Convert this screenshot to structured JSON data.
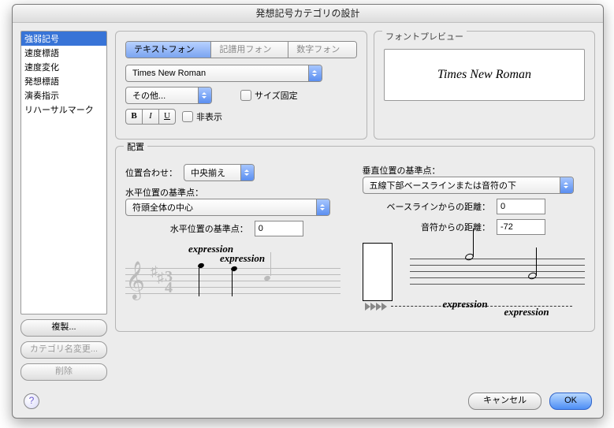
{
  "window": {
    "title": "発想記号カテゴリの設計"
  },
  "sidebar": {
    "items": [
      {
        "label": "強弱記号",
        "selected": true
      },
      {
        "label": "速度標語",
        "selected": false
      },
      {
        "label": "速度変化",
        "selected": false
      },
      {
        "label": "発想標語",
        "selected": false
      },
      {
        "label": "演奏指示",
        "selected": false
      },
      {
        "label": "リハーサルマーク",
        "selected": false
      }
    ],
    "duplicate": "複製...",
    "rename": "カテゴリ名変更...",
    "delete": "削除"
  },
  "tabs": {
    "text_font": "テキストフォント",
    "music_font": "記譜用フォント",
    "number_font": "数字フォント"
  },
  "font": {
    "family": "Times New Roman",
    "other": "その他...",
    "fixed_size_label": "サイズ固定",
    "hide_label": "非表示",
    "bold_glyph": "B",
    "italic_glyph": "I",
    "underline_glyph": "U"
  },
  "preview": {
    "title": "フォントプレビュー",
    "sample": "Times New Roman"
  },
  "positioning": {
    "title": "配置",
    "justify_label": "位置合わせ：",
    "justify_value": "中央揃え",
    "h_ref_title": "水平位置の基準点：",
    "h_ref_value": "符頭全体の中心",
    "h_ref_offset_label": "水平位置の基準点：",
    "h_ref_offset_value": "0",
    "v_ref_title": "垂直位置の基準点：",
    "v_ref_value": "五線下部ベースラインまたは音符の下",
    "baseline_offset_label": "ベースラインからの距離：",
    "baseline_offset_value": "0",
    "note_offset_label": "音符からの距離：",
    "note_offset_value": "-72",
    "expression_word": "expression"
  },
  "buttons": {
    "cancel": "キャンセル",
    "ok": "OK"
  }
}
